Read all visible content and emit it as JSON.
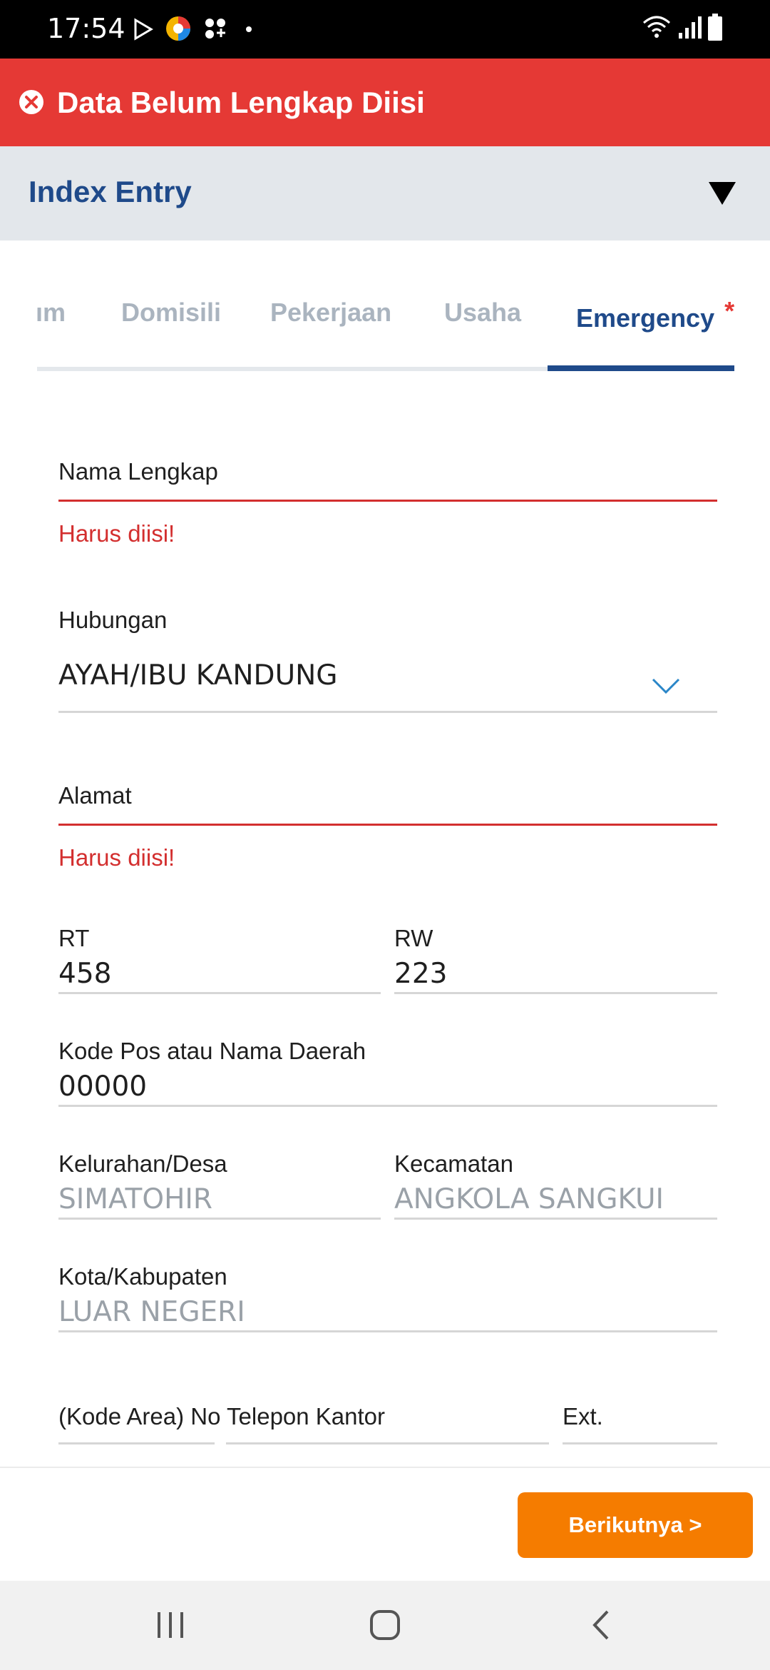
{
  "status_bar": {
    "time": "17:54",
    "icons": [
      "play-store-icon",
      "app-icon",
      "games-icon",
      "dot-icon",
      "wifi-icon",
      "signal-icon",
      "battery-icon"
    ]
  },
  "banner": {
    "title": "Data Belum Lengkap Diisi",
    "color": "#e53935",
    "icon": "close-circle-icon"
  },
  "section": {
    "title": "Index Entry",
    "icon": "caret-down-icon"
  },
  "tabs": [
    {
      "label": "ım"
    },
    {
      "label": "Domisili"
    },
    {
      "label": "Pekerjaan"
    },
    {
      "label": "Usaha"
    },
    {
      "label": "Emergency",
      "required_mark": "*",
      "active": true
    }
  ],
  "form": {
    "nama_lengkap": {
      "label": "Nama Lengkap",
      "value": "",
      "error": "Harus diisi!"
    },
    "hubungan": {
      "label": "Hubungan",
      "value": "AYAH/IBU KANDUNG"
    },
    "alamat": {
      "label": "Alamat",
      "value": "",
      "error": "Harus diisi!"
    },
    "rt": {
      "label": "RT",
      "value": "458"
    },
    "rw": {
      "label": "RW",
      "value": "223"
    },
    "kode_pos": {
      "label": "Kode Pos atau Nama Daerah",
      "value": "00000"
    },
    "kelurahan": {
      "label": "Kelurahan/Desa",
      "value": "SIMATOHIR"
    },
    "kecamatan": {
      "label": "Kecamatan",
      "value": "ANGKOLA SANGKUI"
    },
    "kota": {
      "label": "Kota/Kabupaten",
      "value": "LUAR NEGERI"
    },
    "telepon_kantor": {
      "label": "(Kode Area) No Telepon Kantor",
      "ext_label": "Ext."
    }
  },
  "actions": {
    "next_label": "Berikutnya >",
    "next_color": "#f57c00"
  },
  "nav_bar": {
    "icons": [
      "recent-apps-icon",
      "home-icon",
      "back-icon"
    ]
  }
}
